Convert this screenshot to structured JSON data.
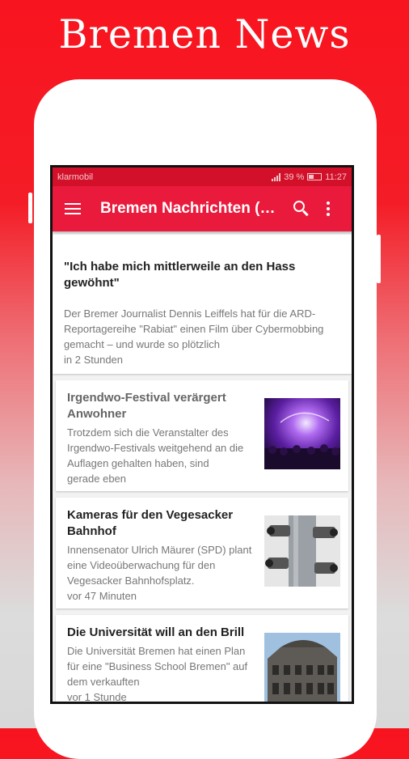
{
  "promo": {
    "title": "Bremen News"
  },
  "status_bar": {
    "carrier": "klarmobil",
    "battery": "39 %",
    "time": "11:27"
  },
  "app_bar": {
    "title": "Bremen Nachrichten (Deutschland)"
  },
  "articles": [
    {
      "title": "\"Ich habe mich mittlerweile an den Hass gewöhnt\"",
      "description": "Der Bremer Journalist Dennis Leiffels hat für die ARD-Reportagereihe \"Rabiat\" einen Film über Cybermobbing gemacht – und wurde so plötzlich",
      "time": "in 2 Stunden"
    },
    {
      "title": "Irgendwo-Festival verärgert Anwohner",
      "description": "Trotzdem sich die Veranstalter des Irgendwo-Festivals weitgehend an die Auflagen gehalten haben, sind",
      "time": "gerade eben",
      "image": "festival-stage-photo"
    },
    {
      "title": "Kameras für den Vegesacker Bahnhof",
      "description": "Innensenator Ulrich Mäurer (SPD) plant eine Videoüberwachung für den Vegesacker Bahnhofsplatz.",
      "time": "vor 47 Minuten",
      "image": "surveillance-cameras-photo"
    },
    {
      "title": "Die Universität will an den Brill",
      "description": "Die Universität Bremen hat einen Plan für eine \"Business School Bremen\" auf dem verkauften",
      "time": "vor 1 Stunde",
      "image": "historic-building-photo"
    }
  ],
  "colors": {
    "accent": "#ea1a3c",
    "status_bar": "#d3102a",
    "background_top": "#f8141f"
  }
}
